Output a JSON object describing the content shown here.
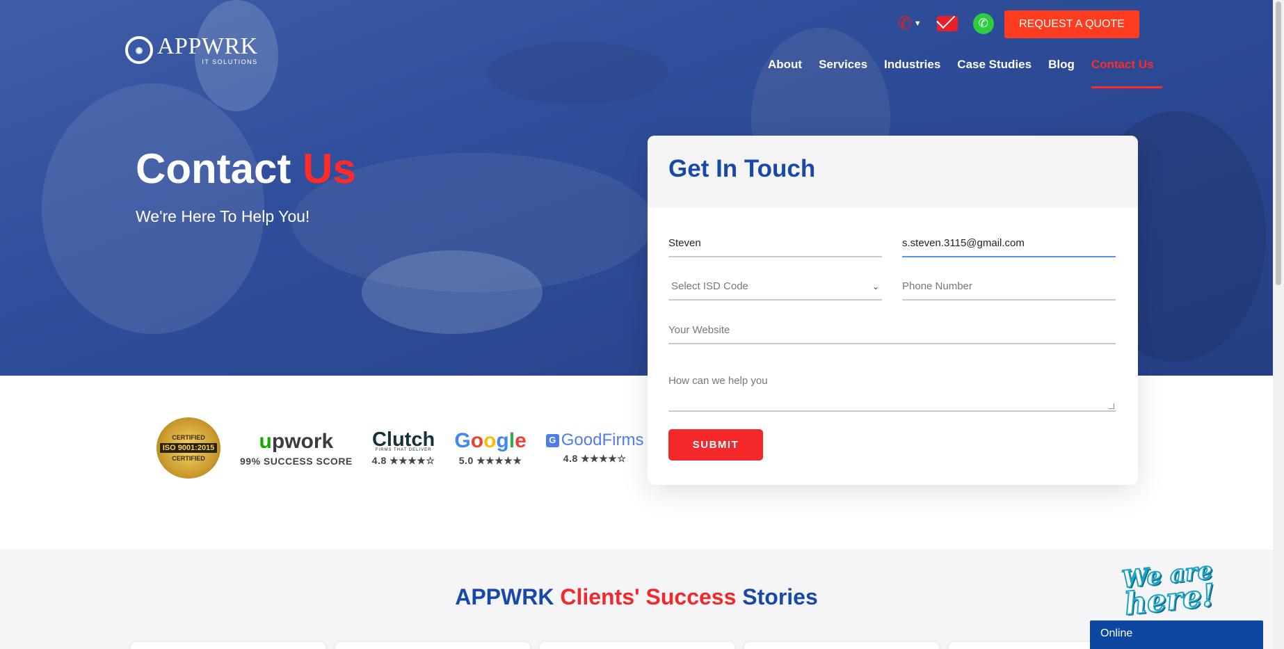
{
  "header": {
    "logo_name": "APPWRK",
    "logo_sub": "IT SOLUTIONS",
    "quote_button": "REQUEST A QUOTE",
    "nav": [
      "About",
      "Services",
      "Industries",
      "Case Studies",
      "Blog",
      "Contact Us"
    ],
    "active_nav": "Contact Us"
  },
  "hero": {
    "title_a": "Contact ",
    "title_b": "Us",
    "subtitle": "We're Here To Help You!"
  },
  "form": {
    "title": "Get In Touch",
    "name_value": "Steven",
    "email_value": "s.steven.3115@gmail.com",
    "isd_placeholder": "Select ISD Code",
    "phone_placeholder": "Phone Number",
    "website_placeholder": "Your Website",
    "help_placeholder": "How can we help you",
    "submit": "SUBMIT"
  },
  "badges": {
    "iso_top": "CERTIFIED",
    "iso_main": "ISO 9001:2015",
    "iso_bottom": "CERTIFIED",
    "upwork_u": "u",
    "upwork_rest": "pwork",
    "upwork_score": "99% SUCCESS SCORE",
    "clutch": "Clutch",
    "clutch_tag": "FIRMS THAT DELIVER",
    "clutch_score": "4.8 ★★★★☆",
    "google_letters": [
      "G",
      "o",
      "o",
      "g",
      "l",
      "e"
    ],
    "google_score": "5.0 ★★★★★",
    "goodfirms": "GoodFirms",
    "goodfirms_score": "4.8 ★★★★☆"
  },
  "stories": {
    "t1": "APPWRK ",
    "t2": "Clients' Success ",
    "t3": "Stories"
  },
  "widgets": {
    "we_are": "We are",
    "here": "here!",
    "online": "Online"
  },
  "colors": {
    "brand_blue": "#1849a9",
    "accent_red": "#f3282b",
    "quote_orange": "#ff3c1e"
  }
}
